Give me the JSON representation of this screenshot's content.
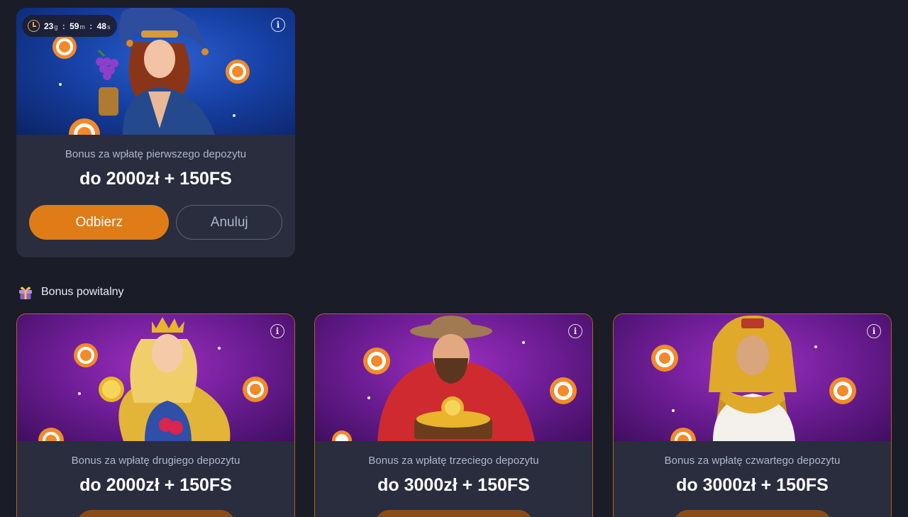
{
  "active_bonus": {
    "timer": {
      "hours": "23",
      "hours_unit": "g",
      "minutes": "59",
      "minutes_unit": "m",
      "seconds": "48",
      "seconds_unit": "s"
    },
    "caption": "Bonus za wpłatę pierwszego depozytu",
    "amount": "do 2000zł + 150FS",
    "claim_label": "Odbierz",
    "cancel_label": "Anuluj"
  },
  "welcome_section": {
    "title": "Bonus powitalny",
    "icon": "gift-icon",
    "cards": [
      {
        "caption": "Bonus za wpłatę drugiego depozytu",
        "amount": "do 2000zł + 150FS"
      },
      {
        "caption": "Bonus za wpłatę trzeciego depozytu",
        "amount": "do 3000zł + 150FS"
      },
      {
        "caption": "Bonus za wpłatę czwartego depozytu",
        "amount": "do 3000zł + 150FS"
      }
    ]
  },
  "colors": {
    "background": "#1a1c28",
    "card": "#292d3d",
    "accent": "#e07c17",
    "muted_text": "#aeb8cc"
  }
}
